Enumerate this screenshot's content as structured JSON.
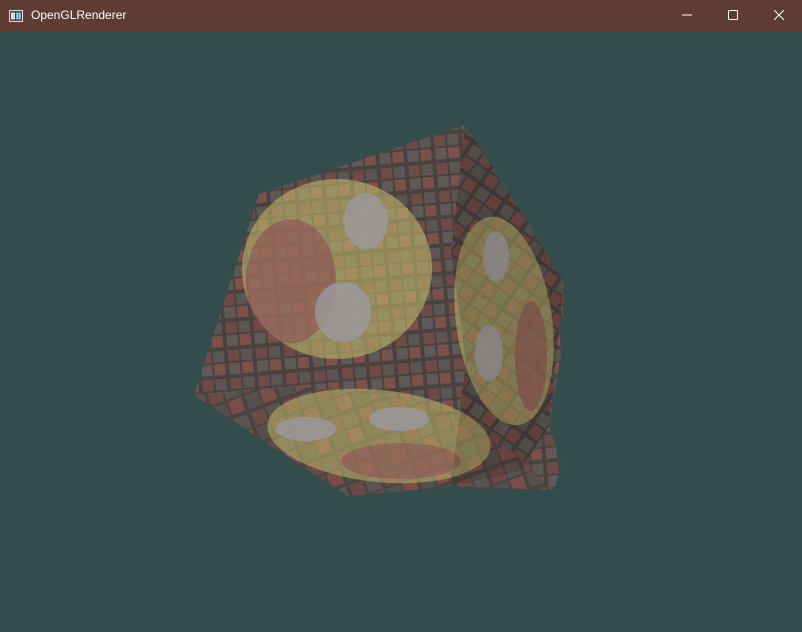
{
  "window": {
    "title": "OpenGLRenderer",
    "icon": "app-window-icon",
    "controls": {
      "minimize_icon": "minimize-icon",
      "maximize_icon": "maximize-icon",
      "close_icon": "close-icon"
    }
  },
  "colors": {
    "titlebar": "#5e3b33",
    "clear_color": "#334d4d",
    "brick_dark": "#4a4240",
    "brick_red": "#7a4a44",
    "face_highlight": "#c9bf6e"
  }
}
